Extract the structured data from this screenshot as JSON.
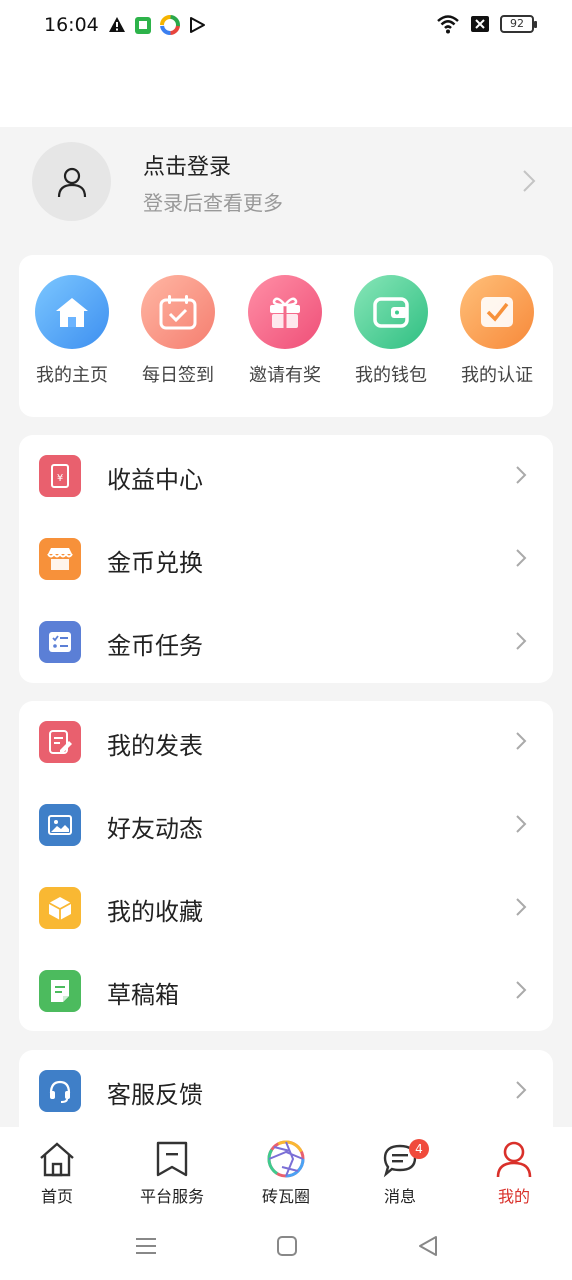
{
  "status": {
    "time": "16:04",
    "battery": "92"
  },
  "login": {
    "title": "点击登录",
    "subtitle": "登录后查看更多"
  },
  "quick": [
    {
      "label": "我的主页",
      "icon": "home-icon",
      "color": "#4aa3f5"
    },
    {
      "label": "每日签到",
      "icon": "calendar-check-icon",
      "color": "#f7927e"
    },
    {
      "label": "邀请有奖",
      "icon": "gift-icon",
      "color": "#f56a8a"
    },
    {
      "label": "我的钱包",
      "icon": "wallet-icon",
      "color": "#3ecb8e"
    },
    {
      "label": "我的认证",
      "icon": "verify-icon",
      "color": "#fb9a45"
    }
  ],
  "menu1": [
    {
      "label": "收益中心",
      "icon": "earnings-icon",
      "color": "#e9606e"
    },
    {
      "label": "金币兑换",
      "icon": "store-icon",
      "color": "#f7913a"
    },
    {
      "label": "金币任务",
      "icon": "task-list-icon",
      "color": "#5b7fd6"
    }
  ],
  "menu2": [
    {
      "label": "我的发表",
      "icon": "edit-post-icon",
      "color": "#e9606e"
    },
    {
      "label": "好友动态",
      "icon": "image-icon",
      "color": "#3f7fc8"
    },
    {
      "label": "我的收藏",
      "icon": "box-icon",
      "color": "#f9b833"
    },
    {
      "label": "草稿箱",
      "icon": "draft-icon",
      "color": "#4cbb5e"
    }
  ],
  "menu3": [
    {
      "label": "客服反馈",
      "icon": "headset-icon",
      "color": "#3f7fc8"
    }
  ],
  "tabs": [
    {
      "label": "首页",
      "icon": "home-outline-icon"
    },
    {
      "label": "平台服务",
      "icon": "bookmark-icon"
    },
    {
      "label": "砖瓦圈",
      "icon": "aperture-icon"
    },
    {
      "label": "消息",
      "icon": "chat-icon",
      "badge": "4"
    },
    {
      "label": "我的",
      "icon": "person-icon",
      "active_color": "#d9302a"
    }
  ]
}
